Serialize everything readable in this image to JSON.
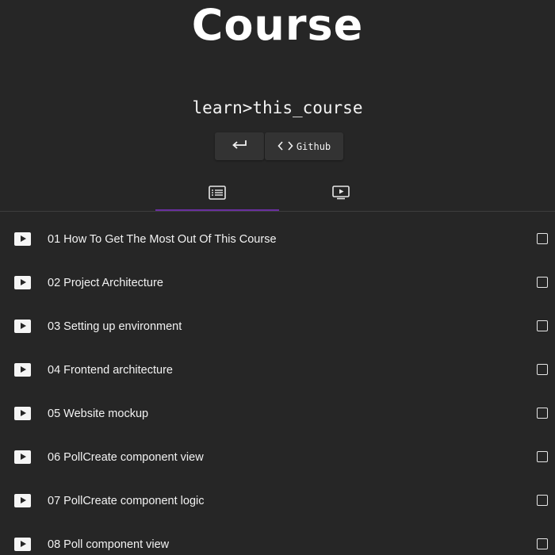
{
  "header": {
    "title": "Course",
    "subtitle": "learn>this_course"
  },
  "actions": {
    "back_icon": "return-arrow-icon",
    "github_icon": "code-brackets-icon",
    "github_label": "Github"
  },
  "tabs": [
    {
      "icon": "list-icon",
      "active": true
    },
    {
      "icon": "video-player-icon",
      "active": false
    }
  ],
  "lessons": [
    {
      "label": "01 How To Get The Most Out Of This Course",
      "checked": false
    },
    {
      "label": "02 Project Architecture",
      "checked": false
    },
    {
      "label": "03 Setting up environment",
      "checked": false
    },
    {
      "label": "04 Frontend architecture",
      "checked": false
    },
    {
      "label": "05 Website mockup",
      "checked": false
    },
    {
      "label": "06 PollCreate component view",
      "checked": false
    },
    {
      "label": "07 PollCreate component logic",
      "checked": false
    },
    {
      "label": "08 Poll component view",
      "checked": false
    }
  ],
  "colors": {
    "background": "#262626",
    "button": "#333333",
    "accent": "#6a2fa0",
    "text": "#f2f2f2"
  }
}
